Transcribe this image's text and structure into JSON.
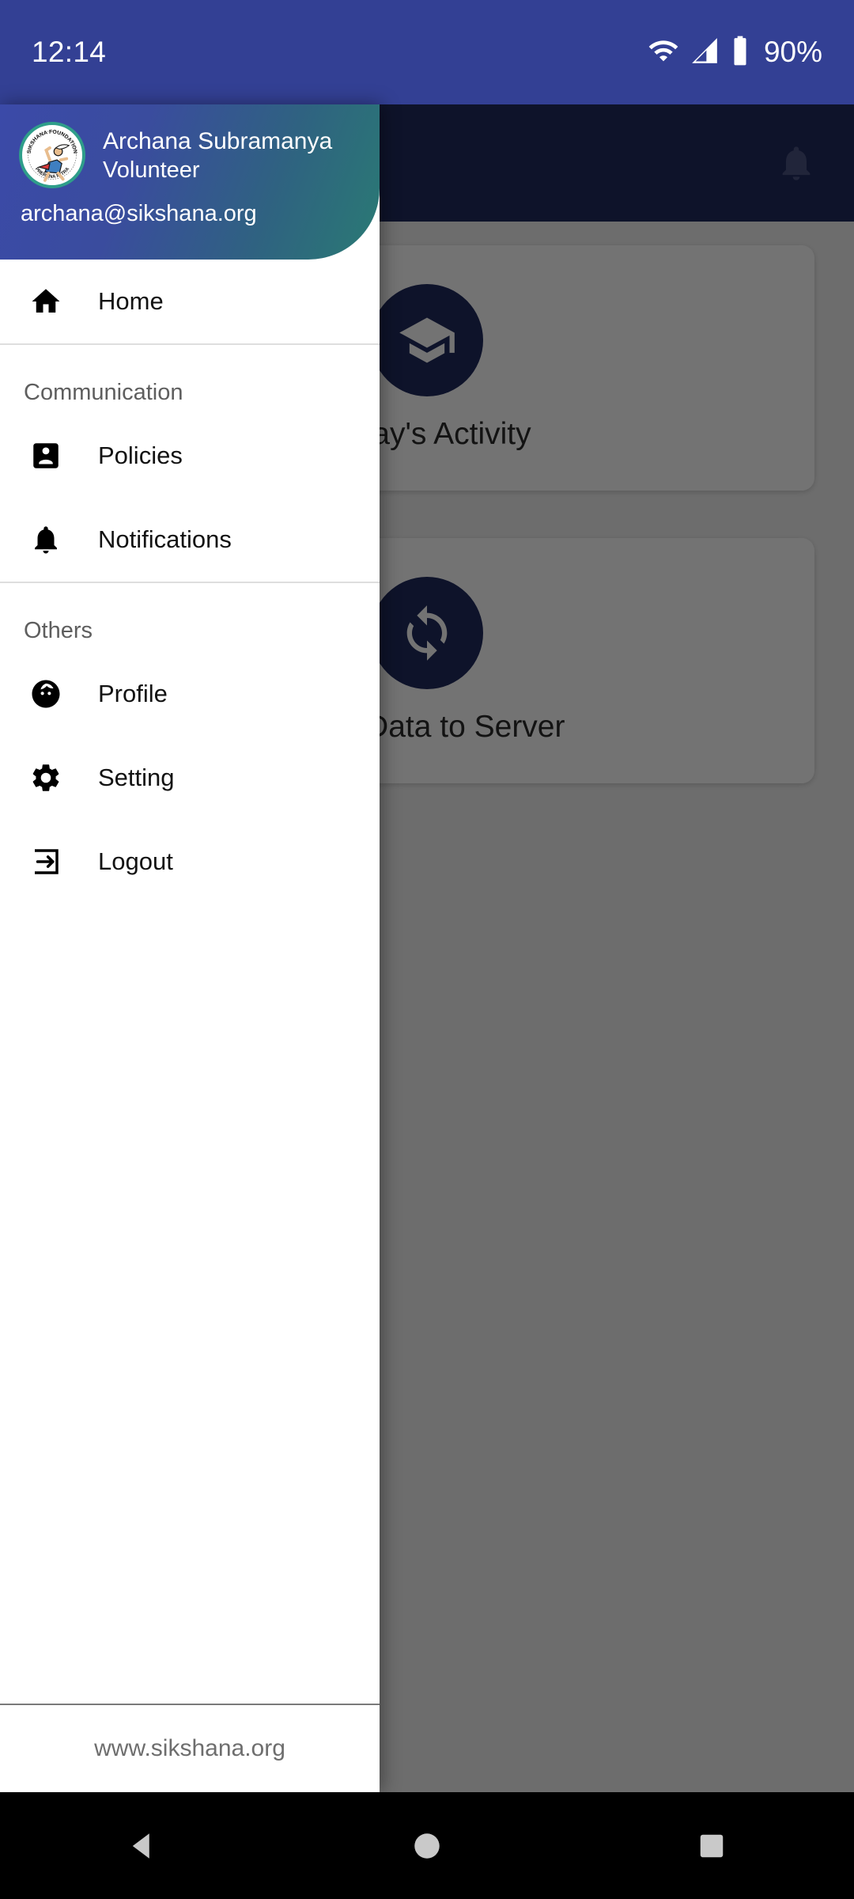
{
  "status_bar": {
    "time": "12:14",
    "battery_percent": "90%",
    "icons": [
      "wifi-icon",
      "cellular-signal-icon",
      "battery-icon"
    ],
    "background_color": "#334094"
  },
  "app_bar": {
    "title": "",
    "notification_icon": "bell-icon",
    "background_color": "#202a5e"
  },
  "background_content": {
    "cards": [
      {
        "label": "Today's Activity",
        "icon": "school-building-icon"
      },
      {
        "label": "Sync Data to Server",
        "icon": "sync-arrows-icon"
      }
    ]
  },
  "drawer": {
    "header": {
      "logo_alt": "Sikshana Foundation",
      "logo_top_text": "SIKSHANA FOUNDATION",
      "logo_bottom_text": "PRERANA MITRA",
      "name": "Archana Subramanya",
      "role": "Volunteer",
      "email": "archana@sikshana.org",
      "gradient_start": "#3b4aa8",
      "gradient_end": "#2a7a74"
    },
    "primary_items": [
      {
        "label": "Home",
        "icon": "home-icon"
      }
    ],
    "sections": [
      {
        "title": "Communication",
        "items": [
          {
            "label": "Policies",
            "icon": "account-box-icon"
          },
          {
            "label": "Notifications",
            "icon": "bell-icon"
          }
        ]
      },
      {
        "title": "Others",
        "items": [
          {
            "label": "Profile",
            "icon": "face-icon"
          },
          {
            "label": "Setting",
            "icon": "gear-icon"
          },
          {
            "label": "Logout",
            "icon": "exit-icon"
          }
        ]
      }
    ],
    "footer": {
      "website": "www.sikshana.org"
    }
  },
  "system_nav": {
    "back": "back-triangle-icon",
    "home": "home-circle-icon",
    "recents": "recents-square-icon"
  }
}
